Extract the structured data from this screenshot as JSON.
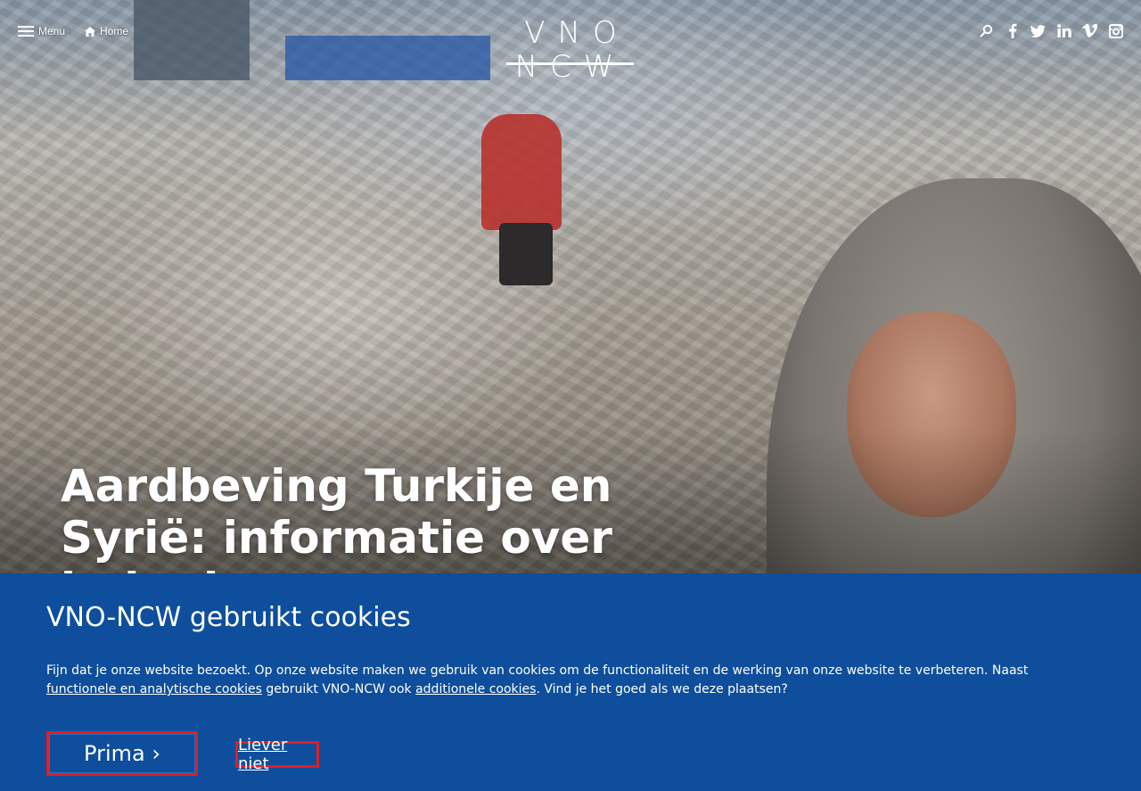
{
  "nav": {
    "menu_label": "Menu",
    "home_label": "Home"
  },
  "logo": {
    "text": "VNO NCW"
  },
  "social": [
    "search-icon",
    "facebook-icon",
    "twitter-icon",
    "linkedin-icon",
    "vimeo-icon",
    "instagram-icon"
  ],
  "hero": {
    "headline": "Aardbeving Turkije en Syrië: informatie over hulp door"
  },
  "cookie": {
    "title": "VNO-NCW gebruikt cookies",
    "text_part1": "Fijn dat je onze website bezoekt. Op onze website maken we gebruik van cookies om de functionaliteit en de werking van onze website te verbeteren. Naast ",
    "link1": "functionele en analytische cookies",
    "text_part2": " gebruikt VNO-NCW ook ",
    "link2": "additionele cookies",
    "text_part3": ". Vind je het goed als we deze plaatsen?",
    "accept_label": "Prima ›",
    "decline_label": "Liever niet"
  },
  "colors": {
    "banner": "#0e4e9c",
    "highlight_border": "#e11d24"
  }
}
